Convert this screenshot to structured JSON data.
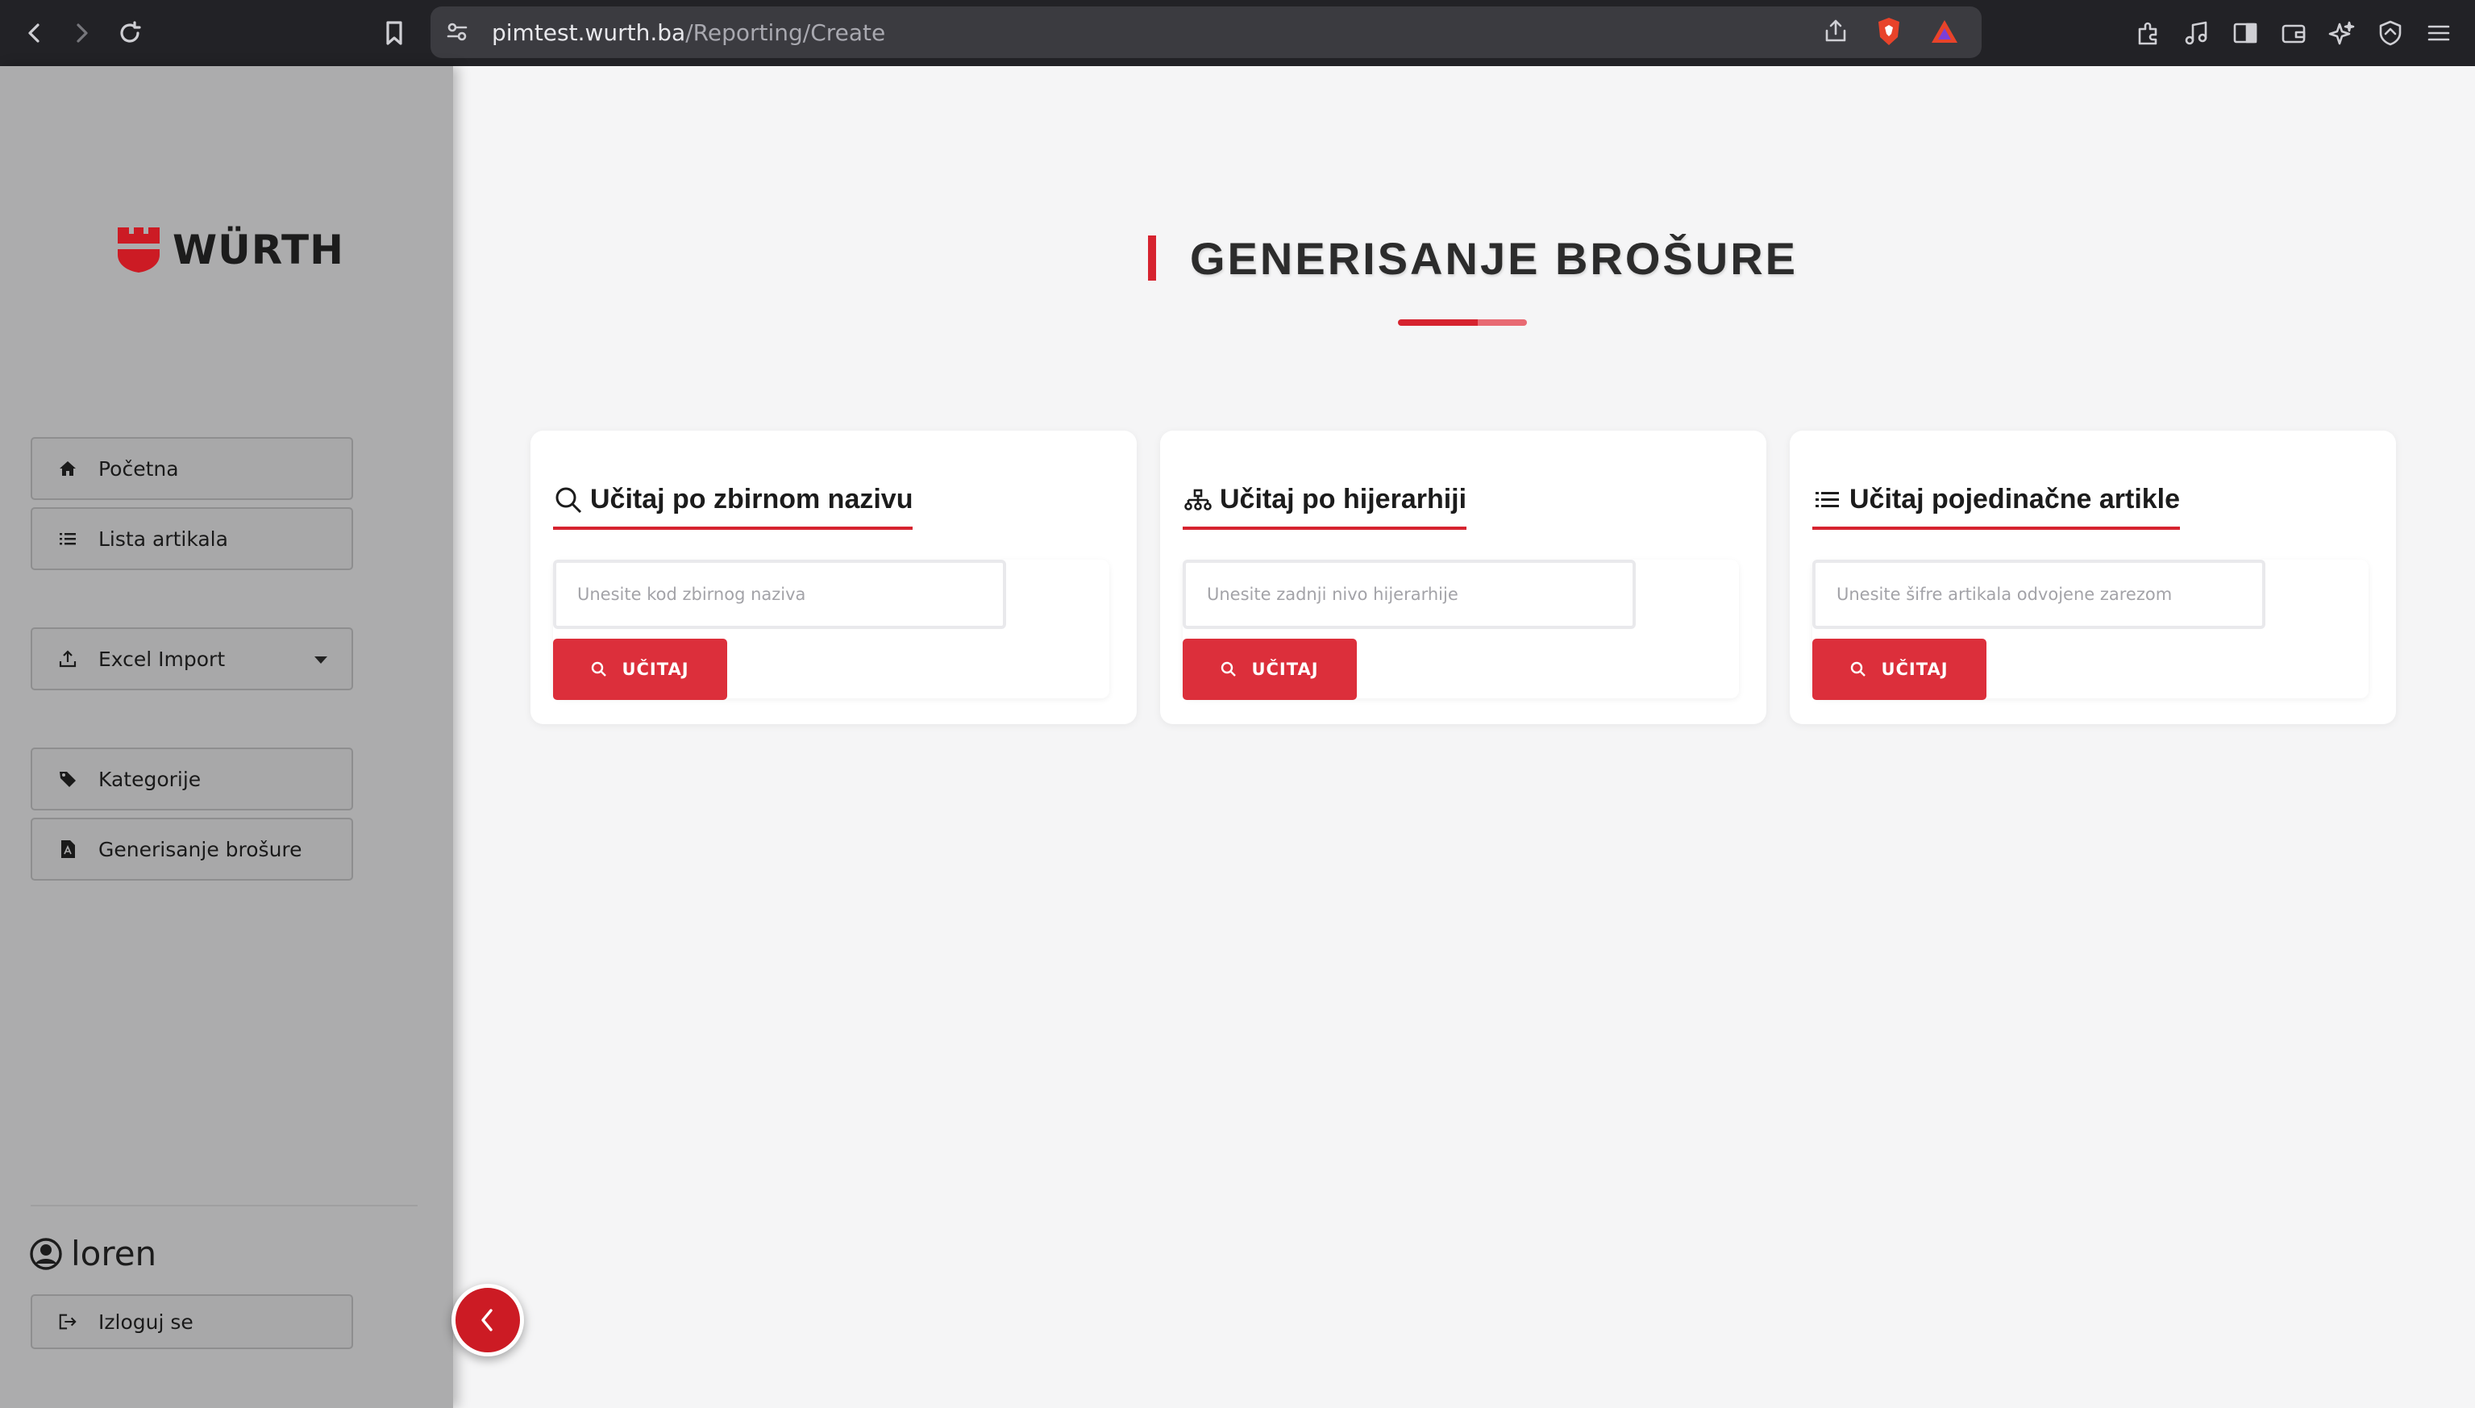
{
  "browser": {
    "url_host": "pimtest.wurth.ba",
    "url_path": "/Reporting/Create"
  },
  "sidebar": {
    "logo_text": "WÜRTH",
    "items": [
      {
        "label": "Početna",
        "icon": "home-icon"
      },
      {
        "label": "Lista artikala",
        "icon": "list-icon"
      },
      {
        "label": "Excel Import",
        "icon": "upload-icon",
        "has_dropdown": true
      },
      {
        "label": "Kategorije",
        "icon": "tag-icon"
      },
      {
        "label": "Generisanje brošure",
        "icon": "pdf-file-icon"
      }
    ],
    "user_name": "loren",
    "logout_label": "Izloguj se"
  },
  "main": {
    "title": "GENERISANJE BROŠURE",
    "cards": [
      {
        "heading": "Učitaj po zbirnom nazivu",
        "icon": "search-icon",
        "placeholder": "Unesite kod zbirnog naziva",
        "button_label": "UČITAJ"
      },
      {
        "heading": "Učitaj po hijerarhiji",
        "icon": "hierarchy-icon",
        "placeholder": "Unesite zadnji nivo hijerarhije",
        "button_label": "UČITAJ"
      },
      {
        "heading": "Učitaj pojedinačne artikle",
        "icon": "list-icon",
        "placeholder": "Unesite šifre artikala odvojene zarezom",
        "button_label": "UČITAJ"
      }
    ]
  },
  "colors": {
    "accent": "#dc2f3b",
    "sidebar_bg": "#acacad",
    "page_bg": "#f5f5f6"
  }
}
